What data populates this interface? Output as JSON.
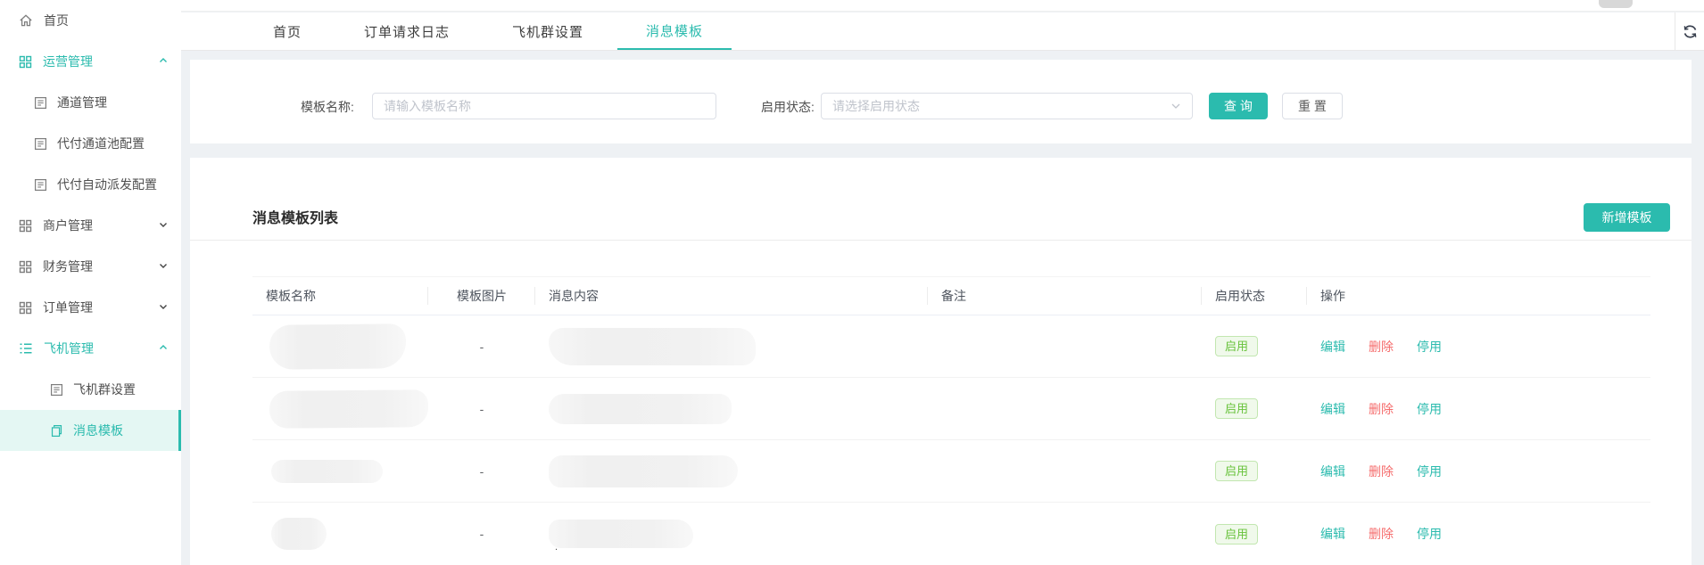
{
  "colors": {
    "accent": "#2bbbae",
    "danger": "#f56c6c",
    "success_text": "#67c23a",
    "success_bg": "#f0f9eb",
    "success_border": "#c2e7b0"
  },
  "sidebar": {
    "items": [
      {
        "label": "首页",
        "icon": "home-icon",
        "level": 1
      },
      {
        "label": "运营管理",
        "icon": "grid-icon",
        "level": 1,
        "chevron": "up",
        "highlight": true
      },
      {
        "label": "通道管理",
        "icon": "doc-list-icon",
        "level": 2
      },
      {
        "label": "代付通道池配置",
        "icon": "doc-list-icon",
        "level": 2
      },
      {
        "label": "代付自动派发配置",
        "icon": "doc-list-icon",
        "level": 2
      },
      {
        "label": "商户管理",
        "icon": "grid-icon",
        "level": 1,
        "chevron": "down"
      },
      {
        "label": "财务管理",
        "icon": "grid-icon",
        "level": 1,
        "chevron": "down"
      },
      {
        "label": "订单管理",
        "icon": "grid-icon",
        "level": 1,
        "chevron": "down"
      },
      {
        "label": "飞机管理",
        "icon": "menu-list-icon",
        "level": 1,
        "chevron": "up",
        "highlight": true
      },
      {
        "label": "飞机群设置",
        "icon": "doc-list-icon",
        "level": 3
      },
      {
        "label": "消息模板",
        "icon": "document-icon",
        "level": 3,
        "active": true
      }
    ]
  },
  "tabs": [
    {
      "label": "首页",
      "active": false
    },
    {
      "label": "订单请求日志",
      "active": false
    },
    {
      "label": "飞机群设置",
      "active": false
    },
    {
      "label": "消息模板",
      "active": true
    }
  ],
  "search": {
    "name_label": "模板名称:",
    "name_placeholder": "请输入模板名称",
    "name_value": "",
    "status_label": "启用状态:",
    "status_placeholder": "请选择启用状态",
    "query_label": "查 询",
    "reset_label": "重 置"
  },
  "list": {
    "title": "消息模板列表",
    "add_button": "新增模板",
    "columns": [
      "模板名称",
      "模板图片",
      "消息内容",
      "备注",
      "启用状态",
      "操作"
    ],
    "rows": [
      {
        "name_redacted": true,
        "image_placeholder": "-",
        "content_redacted": true,
        "remark": "",
        "status": "启用",
        "actions": [
          "编辑",
          "删除",
          "停用"
        ]
      },
      {
        "name_redacted": true,
        "image_placeholder": "-",
        "content_redacted": true,
        "remark": "",
        "status": "启用",
        "actions": [
          "编辑",
          "删除",
          "停用"
        ]
      },
      {
        "name_redacted": true,
        "image_placeholder": "-",
        "content_redacted": true,
        "remark": "",
        "status": "启用",
        "actions": [
          "编辑",
          "删除",
          "停用"
        ]
      },
      {
        "name_redacted": true,
        "image_placeholder": "-",
        "content_redacted": true,
        "content_note": ".",
        "remark": "",
        "status": "启用",
        "actions": [
          "编辑",
          "删除",
          "停用"
        ]
      }
    ]
  }
}
